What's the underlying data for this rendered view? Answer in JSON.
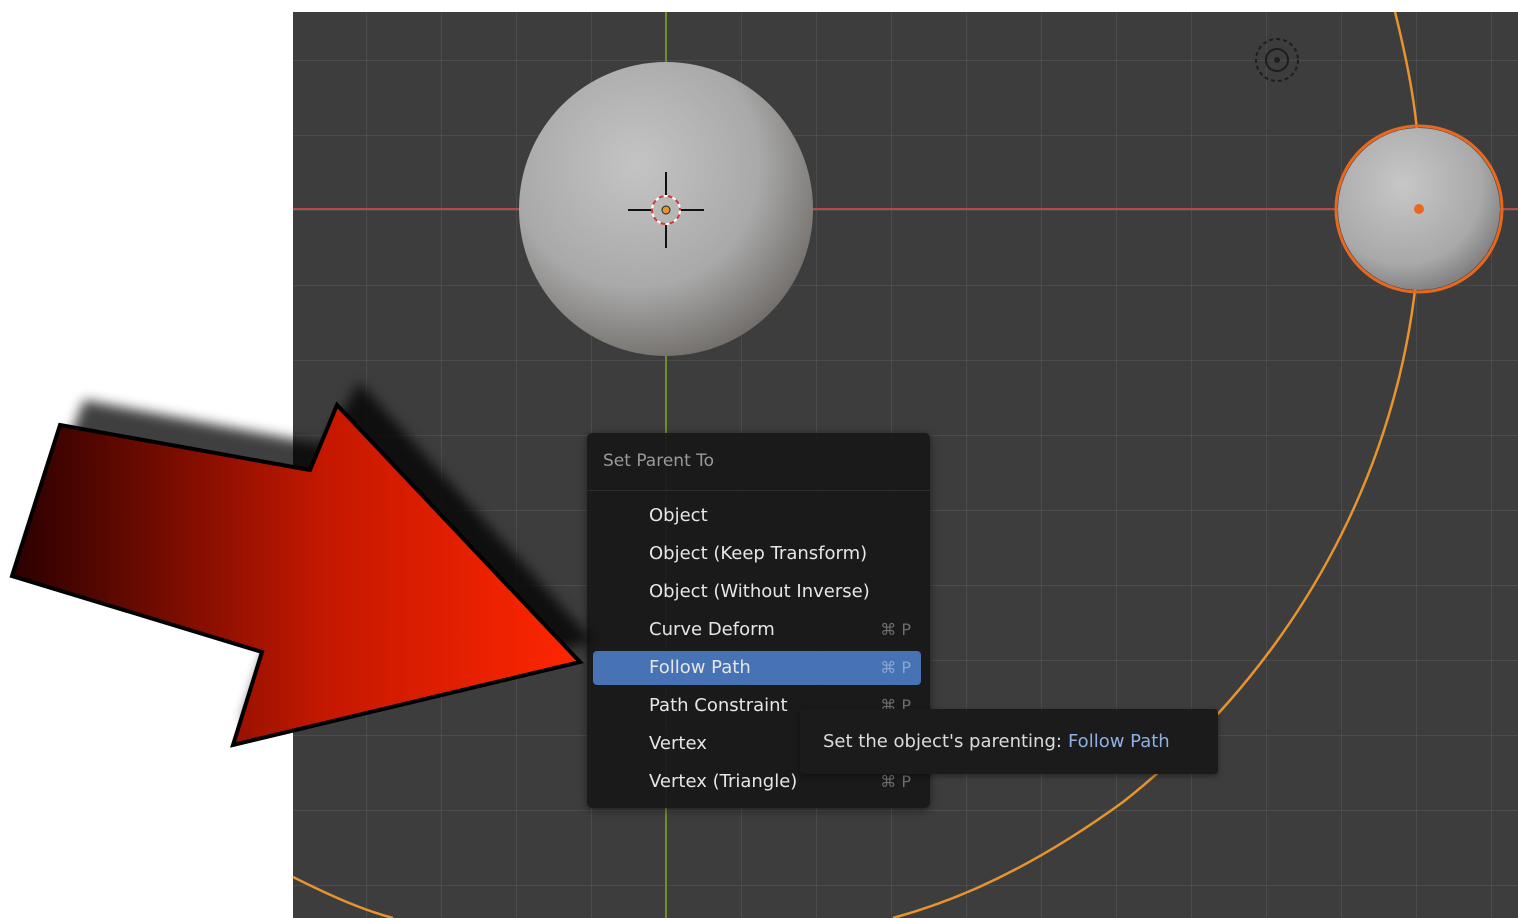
{
  "menu": {
    "title": "Set Parent To",
    "items": [
      {
        "label": "Object",
        "shortcut": ""
      },
      {
        "label": "Object (Keep Transform)",
        "shortcut": ""
      },
      {
        "label": "Object (Without Inverse)",
        "shortcut": ""
      },
      {
        "label": "Curve Deform",
        "shortcut": "⌘ P"
      },
      {
        "label": "Follow Path",
        "shortcut": "⌘ P",
        "active": true
      },
      {
        "label": "Path Constraint",
        "shortcut": "⌘ P"
      },
      {
        "label": "Vertex",
        "shortcut": ""
      },
      {
        "label": "Vertex (Triangle)",
        "shortcut": "⌘ P"
      }
    ]
  },
  "tooltip": {
    "prefix": "Set the object's parenting:",
    "value": "Follow Path"
  },
  "colors": {
    "viewport_bg": "#3d3d3d",
    "x_axis": "#b34a4a",
    "y_axis": "#6c8e2e",
    "curve": "#e8932e",
    "selection_outline": "#e8681f",
    "menu_active": "#4772b3",
    "arrow_start": "#2a0000",
    "arrow_end": "#ff2600"
  },
  "icons": {
    "cursor": "3d-cursor-icon",
    "camera": "camera-target-icon",
    "arrow": "red-pointer-arrow"
  }
}
